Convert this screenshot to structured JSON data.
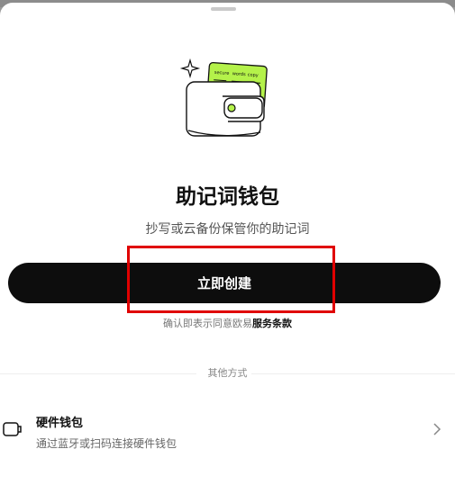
{
  "wallet_option": {
    "title": "助记词钱包",
    "subtitle": "抄写或云备份保管你的助记词",
    "card_words": [
      "secure",
      "words",
      "copy"
    ]
  },
  "create_button": {
    "label": "立即创建"
  },
  "terms": {
    "prefix": "确认即表示同意欧易",
    "link": "服务条款"
  },
  "other_methods": {
    "label": "其他方式"
  },
  "hardware_wallet": {
    "title": "硬件钱包",
    "subtitle": "通过蓝牙或扫码连接硬件钱包"
  },
  "colors": {
    "accent_green": "#b4f24a",
    "button_bg": "#0d0d0d",
    "highlight_red": "#e00000"
  }
}
